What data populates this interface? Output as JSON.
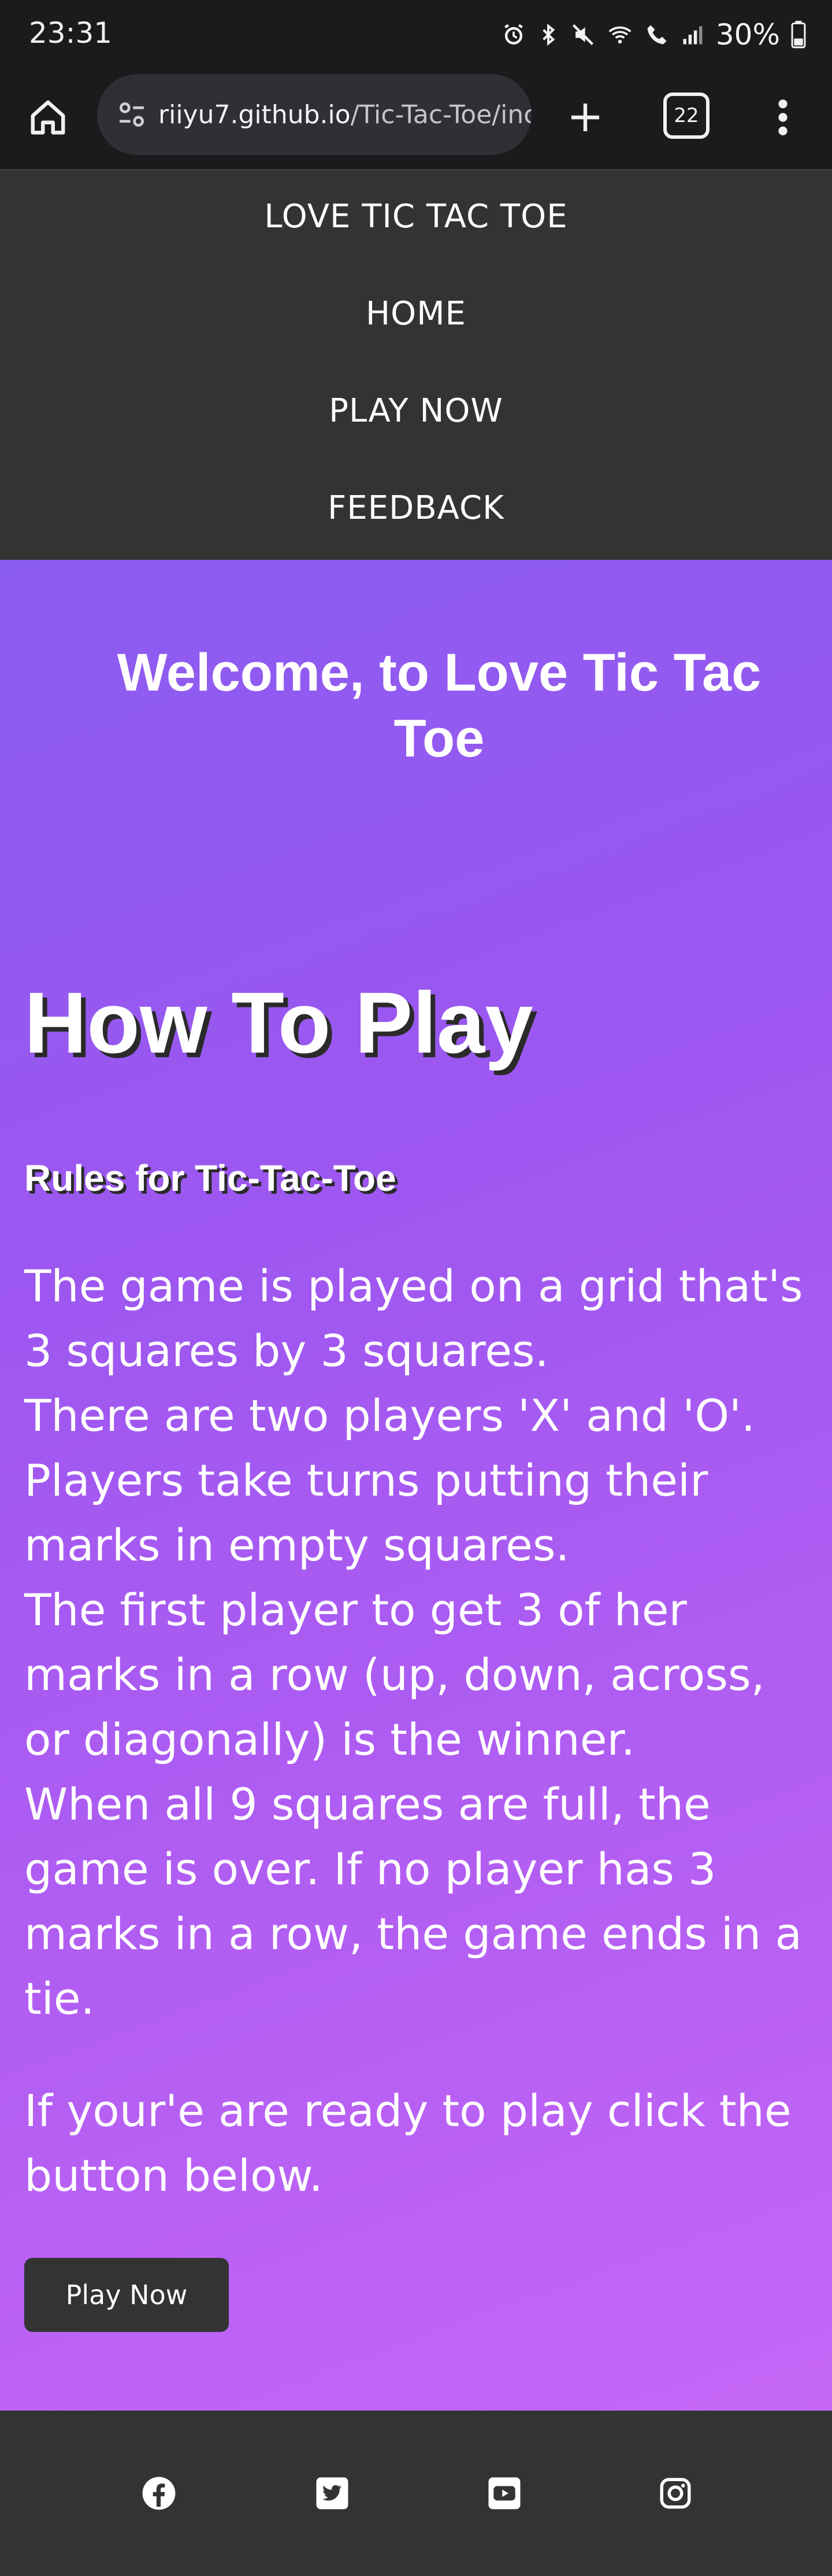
{
  "status_bar": {
    "time": "23:31",
    "battery": "30%"
  },
  "browser": {
    "url_host": "riiyu7.github.io",
    "url_path": "/Tic-Tac-Toe/inc",
    "tab_count": "22"
  },
  "nav": {
    "items": [
      {
        "label": "LOVE TIC TAC TOE"
      },
      {
        "label": "HOME"
      },
      {
        "label": "PLAY NOW"
      },
      {
        "label": "FEEDBACK"
      }
    ]
  },
  "hero": {
    "welcome": "Welcome, to Love Tic Tac Toe",
    "how_to": "How To Play",
    "rules_title": "Rules for Tic-Tac-Toe",
    "rules": [
      "The game is played on a grid that's 3 squares by 3 squares.",
      "There are two players 'X' and 'O'.",
      "Players take turns putting their marks in empty squares.",
      "The first player to get 3 of her marks in a row (up, down, across, or diagonally) is the winner.",
      "When all 9 squares are full, the game is over. If no player has 3 marks in a row, the game ends in a tie."
    ],
    "ready": "If your'e are ready to play click the button below.",
    "play_button": "Play Now"
  },
  "footer": {
    "social": [
      "facebook-icon",
      "twitter-icon",
      "youtube-icon",
      "instagram-icon"
    ]
  },
  "colors": {
    "nav_bg": "#333333",
    "gradient_start": "#8b5cf0",
    "gradient_end": "#c566f6",
    "button_bg": "#333333"
  }
}
